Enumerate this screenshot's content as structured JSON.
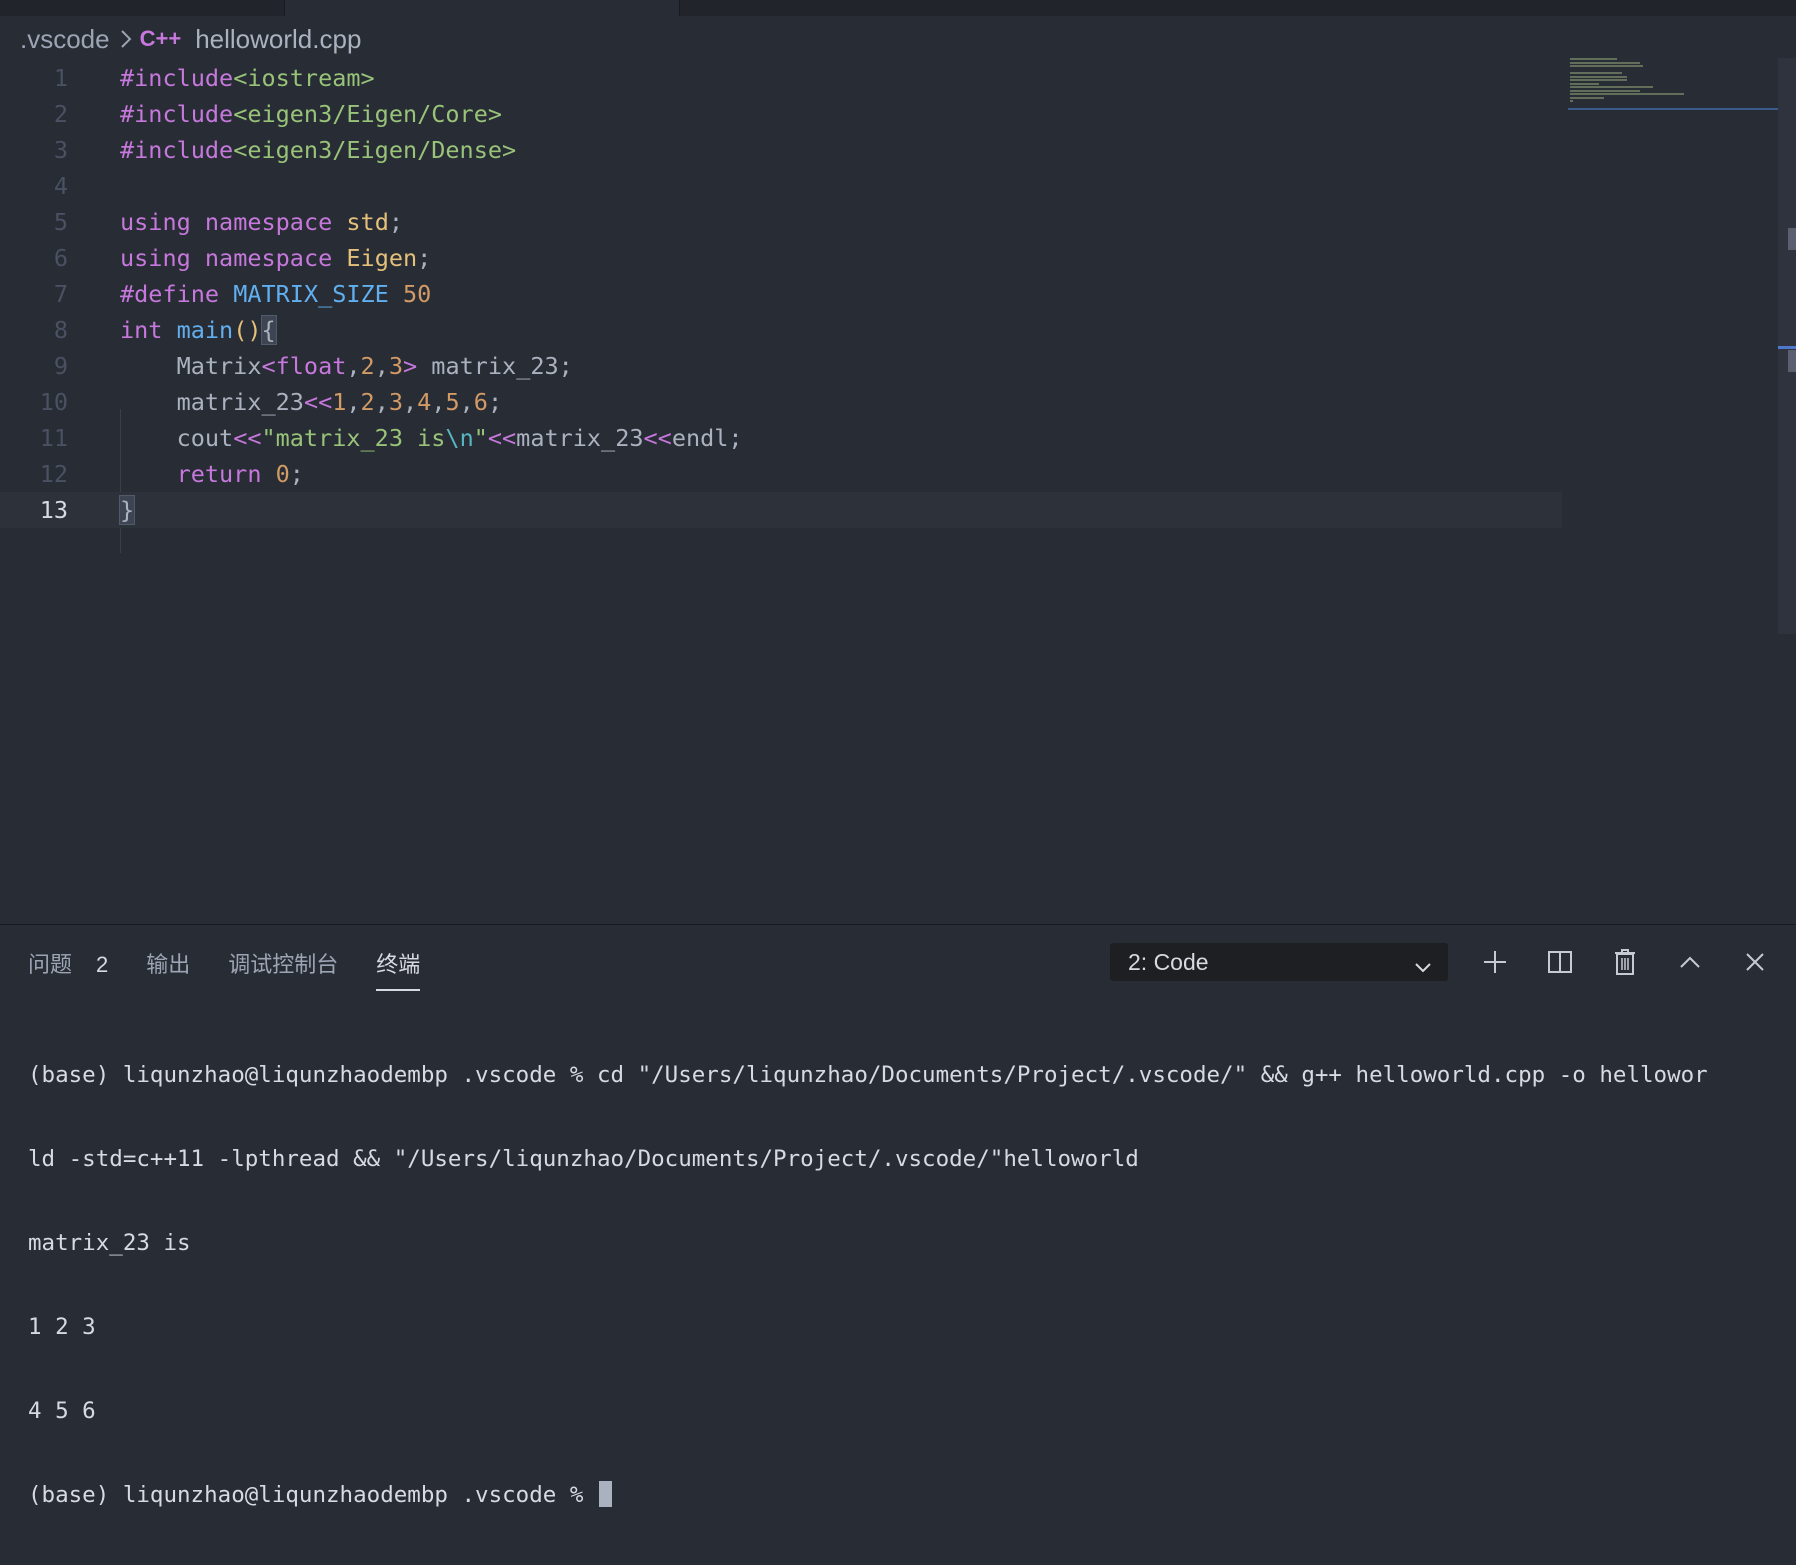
{
  "breadcrumb": {
    "folder": ".vscode",
    "file_icon": "C++",
    "file": "helloworld.cpp"
  },
  "editor": {
    "current_line": 13,
    "lines": [
      {
        "n": "1",
        "tokens": [
          [
            "k",
            "#include"
          ],
          [
            "s",
            "<iostream>"
          ]
        ]
      },
      {
        "n": "2",
        "tokens": [
          [
            "k",
            "#include"
          ],
          [
            "s",
            "<eigen3/Eigen/Core>"
          ]
        ]
      },
      {
        "n": "3",
        "tokens": [
          [
            "k",
            "#include"
          ],
          [
            "s",
            "<eigen3/Eigen/Dense>"
          ]
        ]
      },
      {
        "n": "4",
        "tokens": []
      },
      {
        "n": "5",
        "tokens": [
          [
            "k",
            "using"
          ],
          [
            "t",
            " "
          ],
          [
            "k",
            "namespace"
          ],
          [
            "t",
            " "
          ],
          [
            "y",
            "std"
          ],
          [
            "t",
            ";"
          ]
        ]
      },
      {
        "n": "6",
        "tokens": [
          [
            "k",
            "using"
          ],
          [
            "t",
            " "
          ],
          [
            "k",
            "namespace"
          ],
          [
            "t",
            " "
          ],
          [
            "y",
            "Eigen"
          ],
          [
            "t",
            ";"
          ]
        ]
      },
      {
        "n": "7",
        "tokens": [
          [
            "k",
            "#define"
          ],
          [
            "t",
            " "
          ],
          [
            "f",
            "MATRIX_SIZE"
          ],
          [
            "t",
            " "
          ],
          [
            "n",
            "50"
          ]
        ]
      },
      {
        "n": "8",
        "tokens": [
          [
            "k",
            "int"
          ],
          [
            "t",
            " "
          ],
          [
            "f",
            "main"
          ],
          [
            "y",
            "()"
          ],
          [
            "bm",
            "{"
          ]
        ]
      },
      {
        "n": "9",
        "tokens": [
          [
            "t",
            "    Matrix"
          ],
          [
            "k",
            "<float"
          ],
          [
            "t",
            ","
          ],
          [
            "n",
            "2"
          ],
          [
            "t",
            ","
          ],
          [
            "n",
            "3"
          ],
          [
            "k",
            ">"
          ],
          [
            "t",
            " matrix_23;"
          ]
        ]
      },
      {
        "n": "10",
        "tokens": [
          [
            "t",
            "    matrix_23"
          ],
          [
            "k",
            "<<"
          ],
          [
            "n",
            "1"
          ],
          [
            "t",
            ","
          ],
          [
            "n",
            "2"
          ],
          [
            "t",
            ","
          ],
          [
            "n",
            "3"
          ],
          [
            "t",
            ","
          ],
          [
            "n",
            "4"
          ],
          [
            "t",
            ","
          ],
          [
            "n",
            "5"
          ],
          [
            "t",
            ","
          ],
          [
            "n",
            "6"
          ],
          [
            "t",
            ";"
          ]
        ]
      },
      {
        "n": "11",
        "tokens": [
          [
            "t",
            "    cout"
          ],
          [
            "k",
            "<<"
          ],
          [
            "s",
            "\"matrix_23 is"
          ],
          [
            "c",
            "\\n"
          ],
          [
            "s",
            "\""
          ],
          [
            "k",
            "<<"
          ],
          [
            "t",
            "matrix_23"
          ],
          [
            "k",
            "<<"
          ],
          [
            "t",
            "endl;"
          ]
        ]
      },
      {
        "n": "12",
        "tokens": [
          [
            "t",
            "    "
          ],
          [
            "k",
            "return"
          ],
          [
            "t",
            " "
          ],
          [
            "n",
            "0"
          ],
          [
            "t",
            ";"
          ]
        ]
      },
      {
        "n": "13",
        "tokens": [
          [
            "bm",
            "}"
          ]
        ]
      }
    ]
  },
  "panel": {
    "tabs": [
      {
        "label": "问题",
        "badge": "2",
        "active": false
      },
      {
        "label": "输出",
        "active": false
      },
      {
        "label": "调试控制台",
        "active": false
      },
      {
        "label": "终端",
        "active": true
      }
    ],
    "terminal_select": "2: Code",
    "actions": [
      "plus-icon",
      "split-icon",
      "trash-icon",
      "chevron-up-icon",
      "close-icon"
    ]
  },
  "terminal": {
    "lines": [
      "(base) liqunzhao@liqunzhaodembp .vscode % cd \"/Users/liqunzhao/Documents/Project/.vscode/\" && g++ helloworld.cpp -o hellowor",
      "ld -std=c++11 -lpthread && \"/Users/liqunzhao/Documents/Project/.vscode/\"helloworld",
      "matrix_23 is",
      "1 2 3",
      "4 5 6"
    ],
    "prompt": "(base) liqunzhao@liqunzhaodembp .vscode % "
  }
}
